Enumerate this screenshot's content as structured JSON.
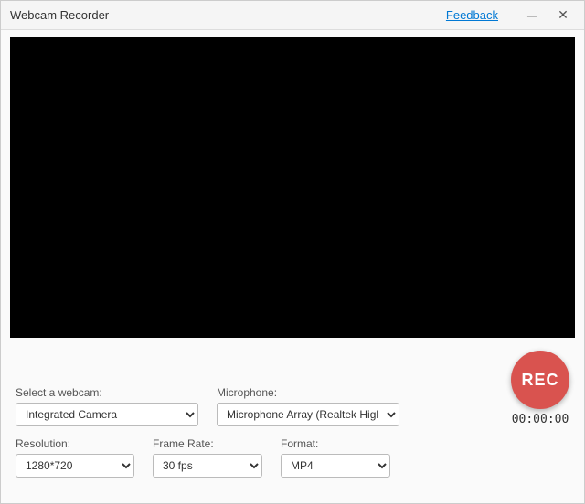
{
  "titleBar": {
    "title": "Webcam Recorder",
    "feedbackLabel": "Feedback",
    "minimizeIcon": "─",
    "closeIcon": "✕"
  },
  "controls": {
    "webcamLabel": "Select a webcam:",
    "webcamValue": "Integrated Camera",
    "micLabel": "Microphone:",
    "micValue": "Microphone Array (Realtek High Def",
    "resolutionLabel": "Resolution:",
    "resolutionValue": "1280*720",
    "frameRateLabel": "Frame Rate:",
    "frameRateValue": "30 fps",
    "formatLabel": "Format:",
    "formatValue": "MP4",
    "recLabel": "REC",
    "timer": "00:00:00"
  }
}
